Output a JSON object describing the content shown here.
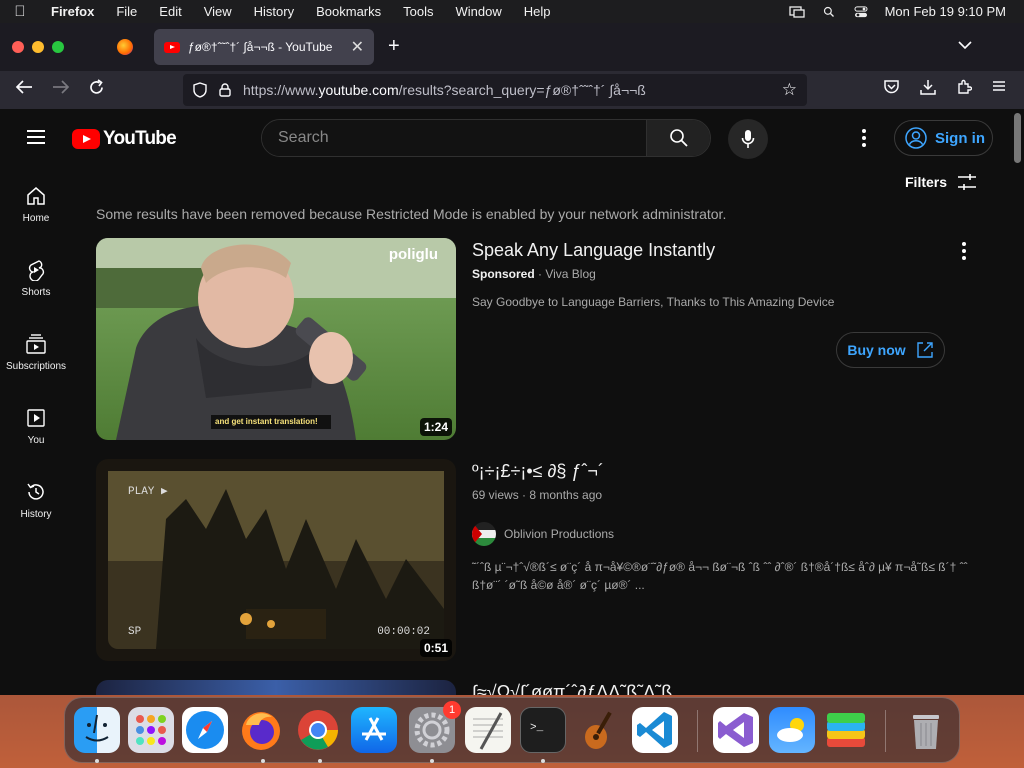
{
  "menubar": {
    "app": "Firefox",
    "items": [
      "File",
      "Edit",
      "View",
      "History",
      "Bookmarks",
      "Tools",
      "Window",
      "Help"
    ],
    "datetime": "Mon Feb 19  9:10 PM"
  },
  "browser": {
    "tab_title": "ƒø®†ˆ˜ˆ†´ ∫å¬¬ß - YouTube",
    "url_prefix": "https://www.",
    "url_domain": "youtube.com",
    "url_path": "/results?search_query=ƒø®†ˆ˜ˆ†´ ∫å¬¬ß"
  },
  "youtube": {
    "logo_text": "YouTube",
    "search_placeholder": "Search",
    "signin_label": "Sign in",
    "filters_label": "Filters",
    "restricted_notice": "Some results have been removed because Restricted Mode is enabled by your network administrator.",
    "sidebar": [
      {
        "label": "Home",
        "icon": "home-icon"
      },
      {
        "label": "Shorts",
        "icon": "shorts-icon"
      },
      {
        "label": "Subscriptions",
        "icon": "subscriptions-icon"
      },
      {
        "label": "You",
        "icon": "you-icon"
      },
      {
        "label": "History",
        "icon": "history-icon"
      }
    ],
    "results": [
      {
        "title": "Speak Any Language Instantly",
        "sponsored": "Sponsored",
        "channel": "Viva Blog",
        "description": "Say Goodbye to Language Barriers, Thanks to This Amazing Device",
        "duration": "1:24",
        "cta": "Buy now",
        "thumb_brand": "poliglu",
        "thumb_caption": "and get instant translation!"
      },
      {
        "title": "º¡÷¡£÷¡•≤ ∂§ ƒˆ¬´",
        "views": "69 views",
        "age": "8 months ago",
        "channel": "Oblivion Productions",
        "description": "˜´ˆß µ¨¬†ˆ√®ß´≤ ø¨ç´ å π¬å¥©®ø¨˜∂ƒø® å¬¬ ßø¨¬ß ˆß ˆˆ ∂ˆ®´ ß†®å´†ß≤ åˆ∂ µ¥ π¬å˜ß≤ ß´† ˆˆ ß†ø¨´ ´ø˜ß å©ø å®´ ø¨ç´ µø®´ ...",
        "duration": "0:51",
        "thumb_play": "PLAY ▶",
        "thumb_sp": "SP",
        "thumb_time": "00:00:02"
      },
      {
        "title": "∫≈√Ω√∫´øøπ´ˆ∂ƒΛΛ˜ß˜Λ˜ß"
      }
    ]
  },
  "dock": {
    "apps": [
      "Finder",
      "Launchpad",
      "Safari",
      "Firefox",
      "Chrome",
      "App Store",
      "System Settings",
      "TextEdit",
      "Terminal",
      "GarageBand",
      "VS Code",
      "Visual Studio",
      "Weather",
      "BlueStacks",
      "Trash"
    ],
    "settings_badge": "1"
  }
}
